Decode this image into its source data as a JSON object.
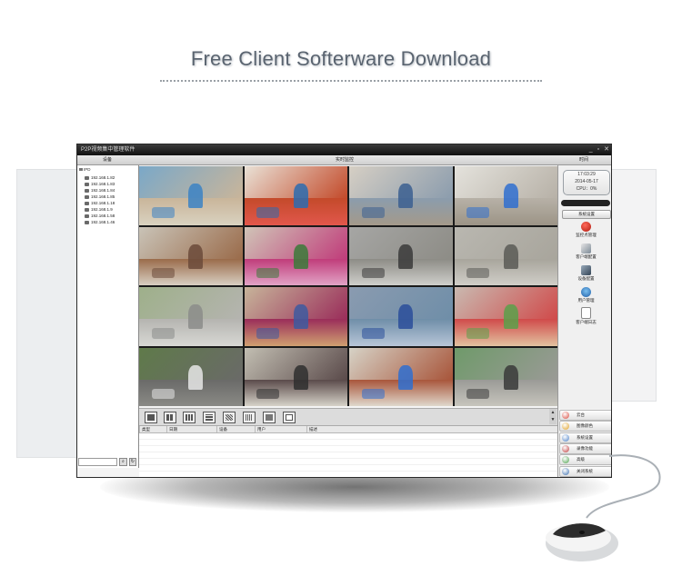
{
  "banner": {
    "title": "Free Client Softerware Download"
  },
  "app": {
    "title": "P2P视频集中管理软件",
    "window_buttons": [
      "_",
      "▫",
      "✕"
    ],
    "headers": {
      "devices": "设备",
      "live": "实时监控",
      "time": "时间"
    },
    "tree": {
      "root": "IPD",
      "items": [
        "192.168.1.82",
        "192.168.1.83",
        "192.168.1.84",
        "192.168.1.85",
        "192.168.1.18",
        "192.168.1.9",
        "192.168.1.58",
        "192.168.1.46"
      ]
    },
    "clock": {
      "time": "17:03:29",
      "date": "2014-05-17",
      "cpu": "CPU：0%"
    },
    "right_panel": {
      "system_settings": "系统设置",
      "items": [
        "监控点管理",
        "客户端配置",
        "设备配置",
        "用户管理",
        "客户端日志"
      ]
    },
    "log_columns": [
      "类型",
      "日期",
      "设备",
      "用户",
      "描述"
    ],
    "bottom_buttons": [
      "云台",
      "图像颜色",
      "系统设置",
      "录像功能",
      "高级",
      "关闭系统"
    ]
  },
  "colors": {
    "app_border": "#2a2a2a",
    "grid_bg": "#1a1a1a",
    "title_text": "#5a6470"
  },
  "icons": {
    "clock": "clock-icon",
    "monitor_points": "monitor-point-icon",
    "client_config": "client-config-icon",
    "device_config": "device-config-icon",
    "user_manage": "user-manage-icon",
    "client_log": "log-file-icon"
  }
}
